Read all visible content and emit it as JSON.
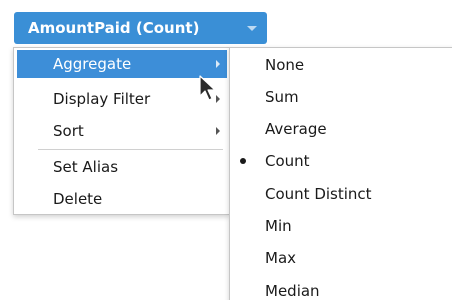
{
  "field_pill": {
    "label": "AmountPaid (Count)"
  },
  "menu": {
    "items": [
      {
        "label": "Aggregate",
        "has_submenu": true,
        "active": true
      },
      {
        "label": "Display Filter",
        "has_submenu": true
      },
      {
        "label": "Sort",
        "has_submenu": true
      },
      {
        "label": "Set Alias",
        "has_submenu": false
      },
      {
        "label": "Delete",
        "has_submenu": false
      }
    ]
  },
  "aggregate_submenu": {
    "selected": "Count",
    "items": [
      {
        "label": "None"
      },
      {
        "label": "Sum"
      },
      {
        "label": "Average"
      },
      {
        "label": "Count"
      },
      {
        "label": "Count Distinct"
      },
      {
        "label": "Min"
      },
      {
        "label": "Max"
      },
      {
        "label": "Median"
      }
    ]
  },
  "colors": {
    "pill_bg": "#3a8fd6",
    "active_item_bg": "#3d8ed8",
    "menu_border": "#c6c6c6"
  }
}
